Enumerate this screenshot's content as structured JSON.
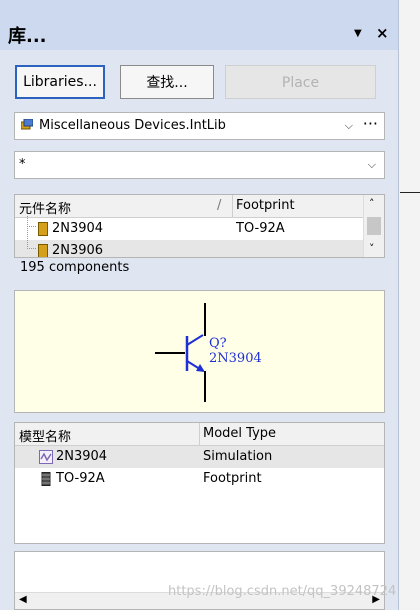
{
  "panel": {
    "title": "库...",
    "pin_glyph": "▼",
    "close_glyph": "×"
  },
  "buttons": {
    "libraries": "Libraries...",
    "search": "查找...",
    "place": "Place"
  },
  "library_select": {
    "value": "Miscellaneous Devices.IntLib",
    "menu_glyph": "···",
    "icon": "library-icon"
  },
  "filter": {
    "value": "*"
  },
  "components_table": {
    "columns": [
      "元件名称",
      "Footprint"
    ],
    "sort_glyph": "/",
    "rows": [
      {
        "name": "2N3904",
        "footprint": "TO-92A"
      },
      {
        "name": "2N3906",
        "footprint": ""
      }
    ],
    "count_text": "195 components"
  },
  "preview": {
    "designator": "Q?",
    "comment": "2N3904"
  },
  "models_table": {
    "columns": [
      "模型名称",
      "Model Type"
    ],
    "rows": [
      {
        "name": "2N3904",
        "type": "Simulation",
        "icon": "simulation-model-icon"
      },
      {
        "name": "TO-92A",
        "type": "Footprint",
        "icon": "footprint-model-icon"
      }
    ]
  },
  "watermark": "https://blog.csdn.net/qq_39248724",
  "colors": {
    "panel_bg": "#dfe6f2",
    "title_bg": "#cdd9ee",
    "preview_bg": "#ffffe8",
    "selected_row": "#e6e6e6",
    "accent": "#2b62c0",
    "symbol_blue": "#1f2fd6"
  }
}
